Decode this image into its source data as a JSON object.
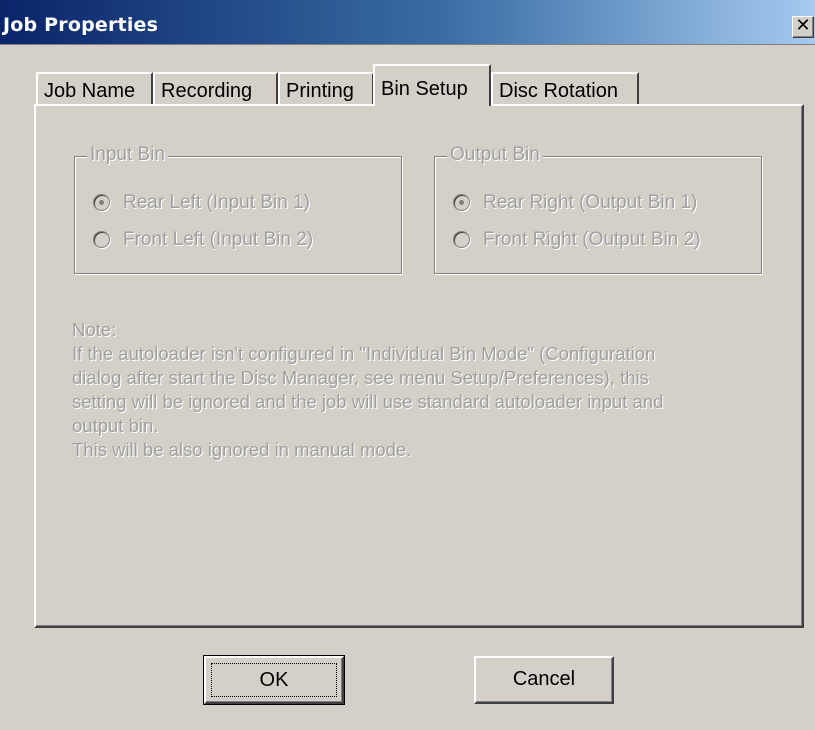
{
  "window": {
    "title": "Job Properties",
    "close_glyph": "✕"
  },
  "tabs": [
    {
      "label": "Job Name"
    },
    {
      "label": "Recording"
    },
    {
      "label": "Printing"
    },
    {
      "label": "Bin Setup",
      "active": true
    },
    {
      "label": "Disc Rotation"
    }
  ],
  "input_bin": {
    "title": "Input Bin",
    "options": [
      {
        "label": "Rear Left (Input Bin 1)",
        "selected": true
      },
      {
        "label": "Front Left (Input Bin 2)",
        "selected": false
      }
    ]
  },
  "output_bin": {
    "title": "Output Bin",
    "options": [
      {
        "label": "Rear Right (Output Bin 1)",
        "selected": true
      },
      {
        "label": "Front Right (Output Bin 2)",
        "selected": false
      }
    ]
  },
  "note": {
    "lines": [
      "Note:",
      "If the autoloader isn't configured in \"Individual Bin Mode\" (Configuration",
      "dialog after start the Disc Manager, see menu Setup/Preferences), this",
      "setting will be ignored and the job will use standard autoloader input and",
      "output bin.",
      "This will be also ignored in manual mode."
    ]
  },
  "buttons": {
    "ok": "OK",
    "cancel": "Cancel"
  },
  "colors": {
    "titlebar_start": "#0a246a",
    "titlebar_end": "#a6caf0",
    "face": "#d4d0c8",
    "disabled_text": "#a0a0a0"
  }
}
